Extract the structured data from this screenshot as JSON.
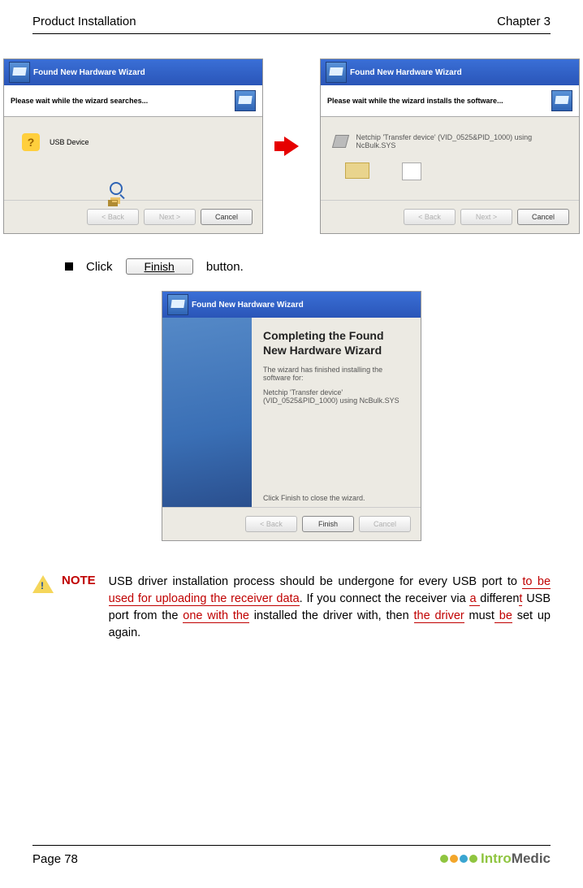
{
  "header": {
    "left": "Product Installation",
    "right": "Chapter 3"
  },
  "dialog_search": {
    "title": "Found New Hardware Wizard",
    "msg": "Please wait while the wizard searches...",
    "device_label": "USB Device",
    "back": "< Back",
    "next": "Next >",
    "cancel": "Cancel"
  },
  "dialog_install": {
    "title": "Found New Hardware Wizard",
    "msg": "Please wait while the wizard installs the software...",
    "device": "Netchip 'Transfer device' (VID_0525&PID_1000) using NcBulk.SYS",
    "back": "< Back",
    "next": "Next >",
    "cancel": "Cancel"
  },
  "bullet": {
    "click": "Click",
    "finish": "Finish",
    "button_word": "button."
  },
  "dialog_complete": {
    "title": "Found New Hardware Wizard",
    "heading": "Completing the Found New Hardware Wizard",
    "line1": "The wizard has finished installing the software for:",
    "device": "Netchip 'Transfer device' (VID_0525&PID_1000) using NcBulk.SYS",
    "close": "Click Finish to close the wizard.",
    "back": "< Back",
    "finish": "Finish",
    "cancel": "Cancel"
  },
  "note": {
    "label": "NOTE",
    "t1": "USB driver installation process should be undergone for every USB port to ",
    "r1": "to be used for uploading the receiver data",
    "t2": ". If you connect the receiver via ",
    "r2": "a ",
    "t3": "differen",
    "r3": "t",
    "t4": " USB port from the ",
    "r4": "one with the",
    "t5": " installed the driver with, then ",
    "r5": "the driver",
    "t6": " must",
    "r6": " be",
    "t7": " set up  again."
  },
  "footer": {
    "page": "Page 78",
    "brand1": "Intro",
    "brand2": "Medic"
  }
}
